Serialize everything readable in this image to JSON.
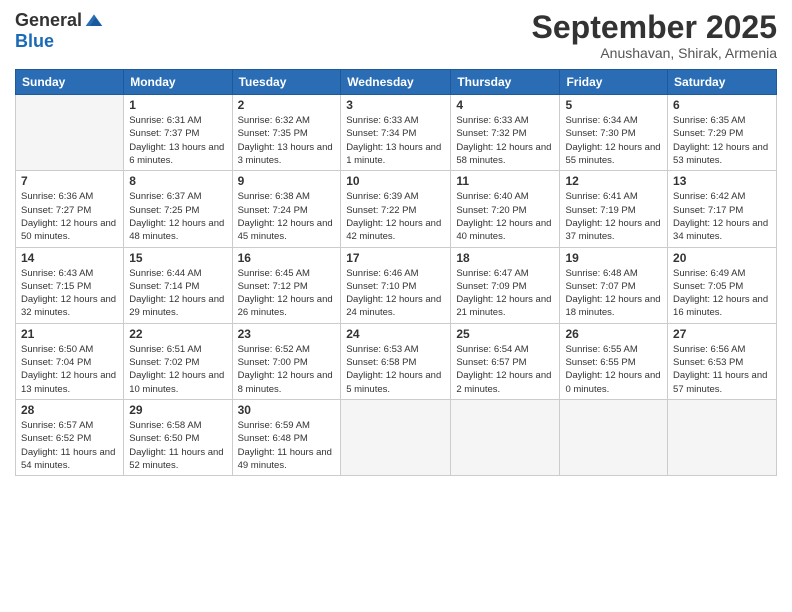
{
  "logo": {
    "general": "General",
    "blue": "Blue"
  },
  "header": {
    "month": "September 2025",
    "location": "Anushavan, Shirak, Armenia"
  },
  "weekdays": [
    "Sunday",
    "Monday",
    "Tuesday",
    "Wednesday",
    "Thursday",
    "Friday",
    "Saturday"
  ],
  "weeks": [
    [
      {
        "day": "",
        "sunrise": "",
        "sunset": "",
        "daylight": ""
      },
      {
        "day": "1",
        "sunrise": "Sunrise: 6:31 AM",
        "sunset": "Sunset: 7:37 PM",
        "daylight": "Daylight: 13 hours and 6 minutes."
      },
      {
        "day": "2",
        "sunrise": "Sunrise: 6:32 AM",
        "sunset": "Sunset: 7:35 PM",
        "daylight": "Daylight: 13 hours and 3 minutes."
      },
      {
        "day": "3",
        "sunrise": "Sunrise: 6:33 AM",
        "sunset": "Sunset: 7:34 PM",
        "daylight": "Daylight: 13 hours and 1 minute."
      },
      {
        "day": "4",
        "sunrise": "Sunrise: 6:33 AM",
        "sunset": "Sunset: 7:32 PM",
        "daylight": "Daylight: 12 hours and 58 minutes."
      },
      {
        "day": "5",
        "sunrise": "Sunrise: 6:34 AM",
        "sunset": "Sunset: 7:30 PM",
        "daylight": "Daylight: 12 hours and 55 minutes."
      },
      {
        "day": "6",
        "sunrise": "Sunrise: 6:35 AM",
        "sunset": "Sunset: 7:29 PM",
        "daylight": "Daylight: 12 hours and 53 minutes."
      }
    ],
    [
      {
        "day": "7",
        "sunrise": "Sunrise: 6:36 AM",
        "sunset": "Sunset: 7:27 PM",
        "daylight": "Daylight: 12 hours and 50 minutes."
      },
      {
        "day": "8",
        "sunrise": "Sunrise: 6:37 AM",
        "sunset": "Sunset: 7:25 PM",
        "daylight": "Daylight: 12 hours and 48 minutes."
      },
      {
        "day": "9",
        "sunrise": "Sunrise: 6:38 AM",
        "sunset": "Sunset: 7:24 PM",
        "daylight": "Daylight: 12 hours and 45 minutes."
      },
      {
        "day": "10",
        "sunrise": "Sunrise: 6:39 AM",
        "sunset": "Sunset: 7:22 PM",
        "daylight": "Daylight: 12 hours and 42 minutes."
      },
      {
        "day": "11",
        "sunrise": "Sunrise: 6:40 AM",
        "sunset": "Sunset: 7:20 PM",
        "daylight": "Daylight: 12 hours and 40 minutes."
      },
      {
        "day": "12",
        "sunrise": "Sunrise: 6:41 AM",
        "sunset": "Sunset: 7:19 PM",
        "daylight": "Daylight: 12 hours and 37 minutes."
      },
      {
        "day": "13",
        "sunrise": "Sunrise: 6:42 AM",
        "sunset": "Sunset: 7:17 PM",
        "daylight": "Daylight: 12 hours and 34 minutes."
      }
    ],
    [
      {
        "day": "14",
        "sunrise": "Sunrise: 6:43 AM",
        "sunset": "Sunset: 7:15 PM",
        "daylight": "Daylight: 12 hours and 32 minutes."
      },
      {
        "day": "15",
        "sunrise": "Sunrise: 6:44 AM",
        "sunset": "Sunset: 7:14 PM",
        "daylight": "Daylight: 12 hours and 29 minutes."
      },
      {
        "day": "16",
        "sunrise": "Sunrise: 6:45 AM",
        "sunset": "Sunset: 7:12 PM",
        "daylight": "Daylight: 12 hours and 26 minutes."
      },
      {
        "day": "17",
        "sunrise": "Sunrise: 6:46 AM",
        "sunset": "Sunset: 7:10 PM",
        "daylight": "Daylight: 12 hours and 24 minutes."
      },
      {
        "day": "18",
        "sunrise": "Sunrise: 6:47 AM",
        "sunset": "Sunset: 7:09 PM",
        "daylight": "Daylight: 12 hours and 21 minutes."
      },
      {
        "day": "19",
        "sunrise": "Sunrise: 6:48 AM",
        "sunset": "Sunset: 7:07 PM",
        "daylight": "Daylight: 12 hours and 18 minutes."
      },
      {
        "day": "20",
        "sunrise": "Sunrise: 6:49 AM",
        "sunset": "Sunset: 7:05 PM",
        "daylight": "Daylight: 12 hours and 16 minutes."
      }
    ],
    [
      {
        "day": "21",
        "sunrise": "Sunrise: 6:50 AM",
        "sunset": "Sunset: 7:04 PM",
        "daylight": "Daylight: 12 hours and 13 minutes."
      },
      {
        "day": "22",
        "sunrise": "Sunrise: 6:51 AM",
        "sunset": "Sunset: 7:02 PM",
        "daylight": "Daylight: 12 hours and 10 minutes."
      },
      {
        "day": "23",
        "sunrise": "Sunrise: 6:52 AM",
        "sunset": "Sunset: 7:00 PM",
        "daylight": "Daylight: 12 hours and 8 minutes."
      },
      {
        "day": "24",
        "sunrise": "Sunrise: 6:53 AM",
        "sunset": "Sunset: 6:58 PM",
        "daylight": "Daylight: 12 hours and 5 minutes."
      },
      {
        "day": "25",
        "sunrise": "Sunrise: 6:54 AM",
        "sunset": "Sunset: 6:57 PM",
        "daylight": "Daylight: 12 hours and 2 minutes."
      },
      {
        "day": "26",
        "sunrise": "Sunrise: 6:55 AM",
        "sunset": "Sunset: 6:55 PM",
        "daylight": "Daylight: 12 hours and 0 minutes."
      },
      {
        "day": "27",
        "sunrise": "Sunrise: 6:56 AM",
        "sunset": "Sunset: 6:53 PM",
        "daylight": "Daylight: 11 hours and 57 minutes."
      }
    ],
    [
      {
        "day": "28",
        "sunrise": "Sunrise: 6:57 AM",
        "sunset": "Sunset: 6:52 PM",
        "daylight": "Daylight: 11 hours and 54 minutes."
      },
      {
        "day": "29",
        "sunrise": "Sunrise: 6:58 AM",
        "sunset": "Sunset: 6:50 PM",
        "daylight": "Daylight: 11 hours and 52 minutes."
      },
      {
        "day": "30",
        "sunrise": "Sunrise: 6:59 AM",
        "sunset": "Sunset: 6:48 PM",
        "daylight": "Daylight: 11 hours and 49 minutes."
      },
      {
        "day": "",
        "sunrise": "",
        "sunset": "",
        "daylight": ""
      },
      {
        "day": "",
        "sunrise": "",
        "sunset": "",
        "daylight": ""
      },
      {
        "day": "",
        "sunrise": "",
        "sunset": "",
        "daylight": ""
      },
      {
        "day": "",
        "sunrise": "",
        "sunset": "",
        "daylight": ""
      }
    ]
  ]
}
